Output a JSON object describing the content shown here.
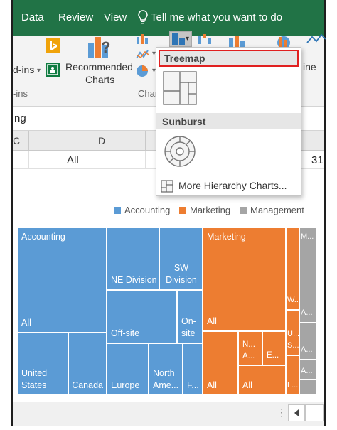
{
  "ribbon": {
    "tabs": [
      "Data",
      "Review",
      "View"
    ],
    "tell_me": "Tell me what you want to do",
    "addins_label": "d-ins",
    "addins_group": "-ins",
    "recommended_charts_line1": "Recommended",
    "recommended_charts_line2": "Charts",
    "charts_group": "Char",
    "line_label": "ine"
  },
  "namebox": "ng",
  "columns": [
    "C",
    "D"
  ],
  "row1": {
    "d_value": "All",
    "right_value": "31"
  },
  "treemap_menu": {
    "treemap_header": "Treemap",
    "sunburst_header": "Sunburst",
    "more_link": "More Hierarchy Charts..."
  },
  "legend": [
    {
      "label": "Accounting",
      "color": "#5b9bd5"
    },
    {
      "label": "Marketing",
      "color": "#ed7d31"
    },
    {
      "label": "Management",
      "color": "#a5a5a5"
    }
  ],
  "tiles": {
    "accounting_top": "Accounting",
    "accounting_all": "All",
    "ne_division": "NE Division",
    "sw_division": "SW Division",
    "offsite": "Off-site",
    "onsite": "On-site",
    "united_states": "United States",
    "canada": "Canada",
    "europe": "Europe",
    "north_america": "North Ame...",
    "f_tile": "F...",
    "marketing_top": "Marketing",
    "marketing_all": "All",
    "marketing_all2": "All",
    "marketing_all3": "All",
    "m_n": "N...",
    "m_a": "A...",
    "m_e": "E...",
    "m_w": "W...",
    "m_u": "U...",
    "m_s": "S...",
    "m_l": "L...",
    "mgmt_top": "M...",
    "mgmt_a": "A...",
    "mgmt_a2": "A...",
    "mgmt_a3": "A..."
  }
}
